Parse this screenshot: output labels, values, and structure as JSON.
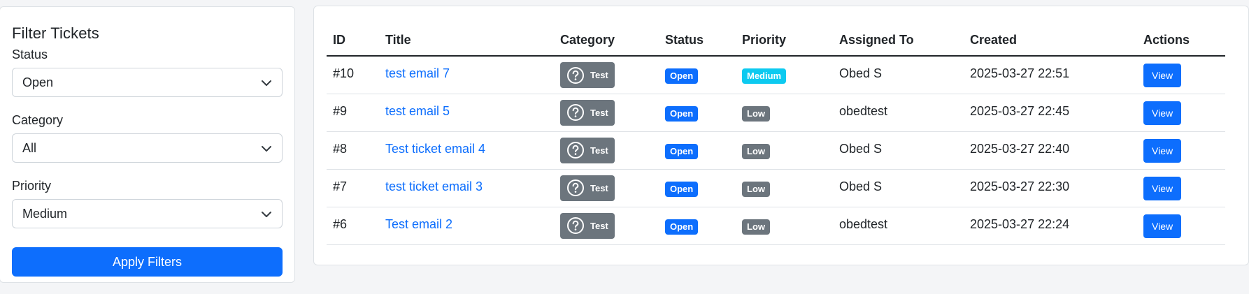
{
  "filter": {
    "title": "Filter Tickets",
    "status_label": "Status",
    "status_value": "Open",
    "category_label": "Category",
    "category_value": "All",
    "priority_label": "Priority",
    "priority_value": "Medium",
    "apply_label": "Apply Filters"
  },
  "table": {
    "columns": [
      "ID",
      "Title",
      "Category",
      "Status",
      "Priority",
      "Assigned To",
      "Created",
      "Actions"
    ],
    "rows": [
      {
        "id": "#10",
        "title": "test email 7",
        "category": "Test",
        "status": "Open",
        "priority": "Medium",
        "assigned": "Obed S",
        "created": "2025-03-27 22:51",
        "action": "View"
      },
      {
        "id": "#9",
        "title": "test email 5",
        "category": "Test",
        "status": "Open",
        "priority": "Low",
        "assigned": "obedtest",
        "created": "2025-03-27 22:45",
        "action": "View"
      },
      {
        "id": "#8",
        "title": "Test ticket email 4",
        "category": "Test",
        "status": "Open",
        "priority": "Low",
        "assigned": "Obed S",
        "created": "2025-03-27 22:40",
        "action": "View"
      },
      {
        "id": "#7",
        "title": "test ticket email 3",
        "category": "Test",
        "status": "Open",
        "priority": "Low",
        "assigned": "Obed S",
        "created": "2025-03-27 22:30",
        "action": "View"
      },
      {
        "id": "#6",
        "title": "Test email 2",
        "category": "Test",
        "status": "Open",
        "priority": "Low",
        "assigned": "obedtest",
        "created": "2025-03-27 22:24",
        "action": "View"
      }
    ]
  },
  "icons": {
    "category": "question-circle-icon",
    "select": "chevron-down-icon"
  },
  "colors": {
    "primary": "#0d6efd",
    "secondary": "#6c757d",
    "info": "#0dcaf0"
  }
}
